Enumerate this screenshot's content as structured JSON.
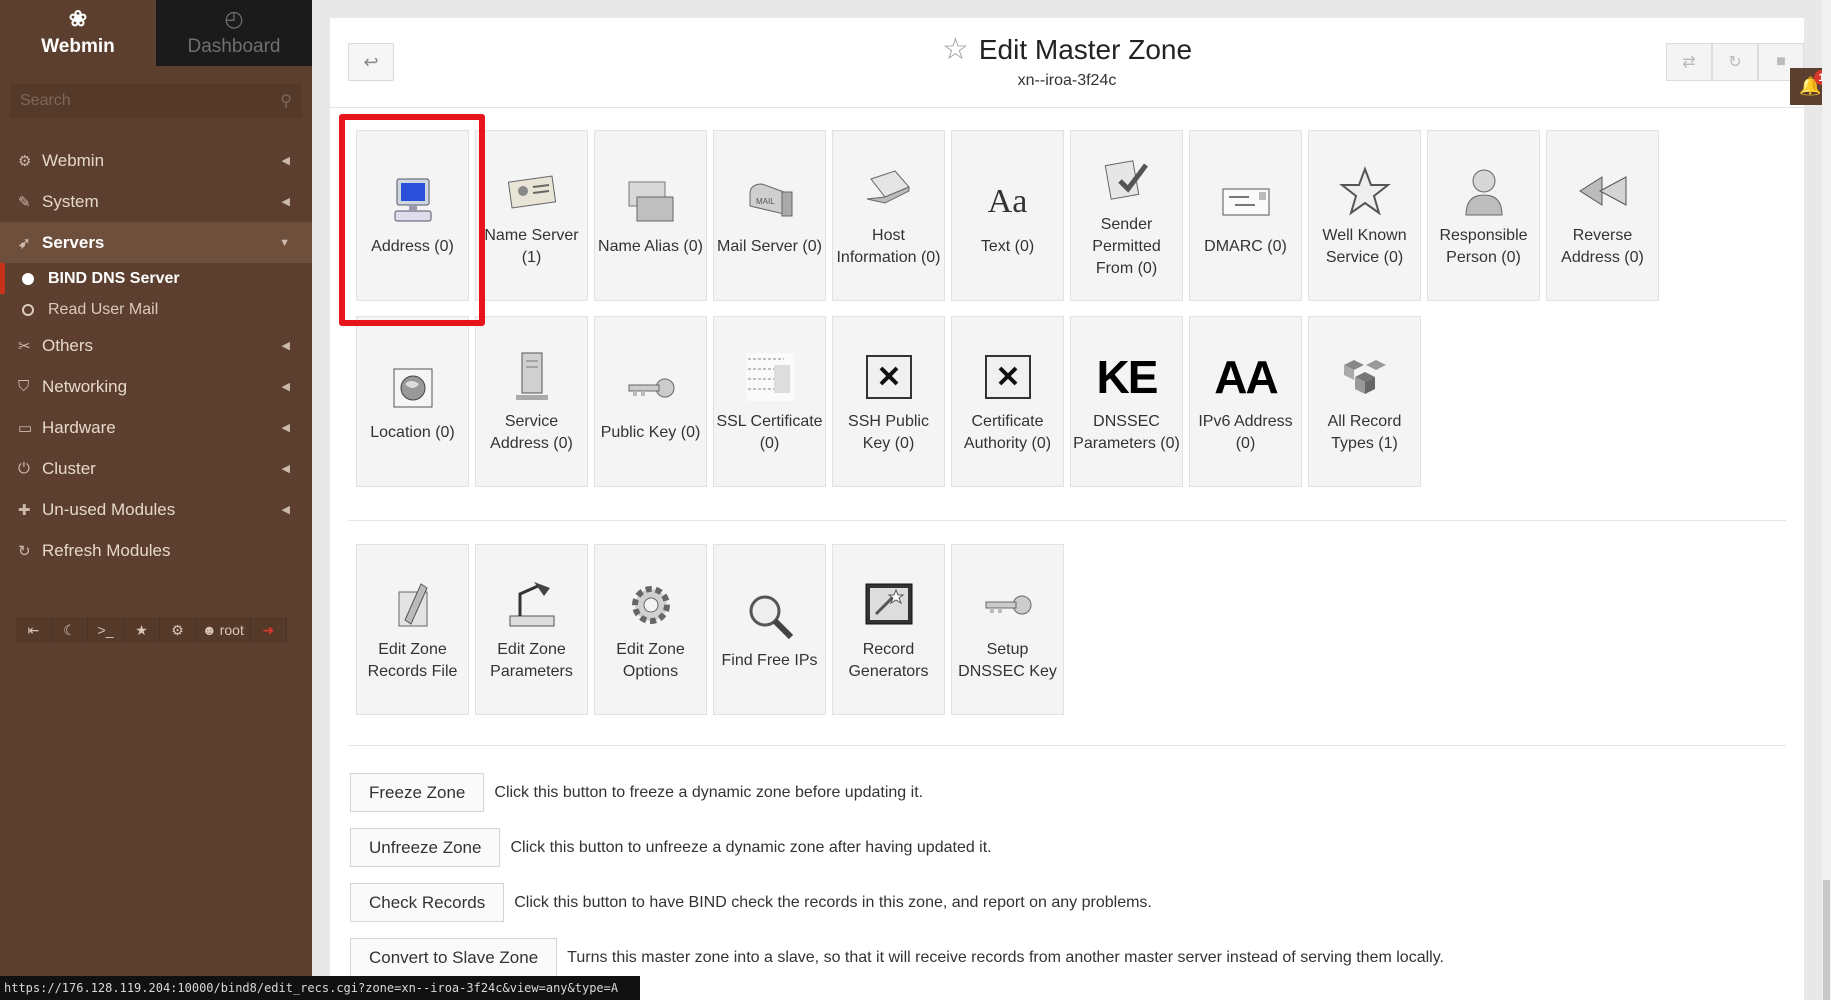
{
  "sidebar": {
    "tabs": [
      {
        "label": "Webmin",
        "icon": "webmin-logo-icon"
      },
      {
        "label": "Dashboard",
        "icon": "dashboard-icon"
      }
    ],
    "search_placeholder": "Search",
    "menu": [
      {
        "label": "Webmin",
        "icon": "gear-icon"
      },
      {
        "label": "System",
        "icon": "wrench-icon"
      },
      {
        "label": "Servers",
        "icon": "rocket-icon"
      },
      {
        "label": "Others",
        "icon": "tools-icon"
      },
      {
        "label": "Networking",
        "icon": "shield-icon"
      },
      {
        "label": "Hardware",
        "icon": "hdd-icon"
      },
      {
        "label": "Cluster",
        "icon": "power-icon"
      },
      {
        "label": "Un-used Modules",
        "icon": "puzzle-icon"
      },
      {
        "label": "Refresh Modules",
        "icon": "refresh-icon"
      }
    ],
    "sub_items": [
      {
        "label": "BIND DNS Server"
      },
      {
        "label": "Read User Mail"
      }
    ],
    "user": "root"
  },
  "header": {
    "title": "Edit Master Zone",
    "subtitle": "xn--iroa-3f24c"
  },
  "tiles_row1": [
    {
      "label": "Address (0)"
    },
    {
      "label": "Name Server (1)"
    },
    {
      "label": "Name Alias (0)"
    },
    {
      "label": "Mail Server (0)"
    },
    {
      "label": "Host Information (0)"
    },
    {
      "label": "Text (0)"
    },
    {
      "label": "Sender Permitted From (0)"
    },
    {
      "label": "DMARC (0)"
    },
    {
      "label": "Well Known Service (0)"
    },
    {
      "label": "Responsible Person (0)"
    },
    {
      "label": "Reverse Address (0)"
    }
  ],
  "tiles_row2": [
    {
      "label": "Location (0)"
    },
    {
      "label": "Service Address (0)"
    },
    {
      "label": "Public Key (0)"
    },
    {
      "label": "SSL Certificate (0)"
    },
    {
      "label": "SSH Public Key (0)"
    },
    {
      "label": "Certificate Authority (0)"
    },
    {
      "label": "DNSSEC Parameters (0)"
    },
    {
      "label": "IPv6 Address (0)"
    },
    {
      "label": "All Record Types (1)"
    }
  ],
  "tiles_row3": [
    {
      "label": "Edit Zone Records File"
    },
    {
      "label": "Edit Zone Parameters"
    },
    {
      "label": "Edit Zone Options"
    },
    {
      "label": "Find Free IPs"
    },
    {
      "label": "Record Generators"
    },
    {
      "label": "Setup DNSSEC Key"
    }
  ],
  "tile_icon_text": {
    "text": "Aa",
    "dnssec": "KE",
    "ipv6": "AA"
  },
  "actions": [
    {
      "button": "Freeze Zone",
      "desc": "Click this button to freeze a dynamic zone before updating it."
    },
    {
      "button": "Unfreeze Zone",
      "desc": "Click this button to unfreeze a dynamic zone after having updated it."
    },
    {
      "button": "Check Records",
      "desc": "Click this button to have BIND check the records in this zone, and report on any problems."
    },
    {
      "button": "Convert to Slave Zone",
      "desc": "Turns this master zone into a slave, so that it will receive records from another master server instead of serving them locally."
    }
  ],
  "notifications": {
    "count": "1"
  },
  "status_url": "https://176.128.119.204:10000/bind8/edit_recs.cgi?zone=xn--iroa-3f24c&view=any&type=A",
  "colors": {
    "sidebar": "#5c3f2e",
    "highlight": "#e8141c",
    "accent": "#c8321b"
  }
}
